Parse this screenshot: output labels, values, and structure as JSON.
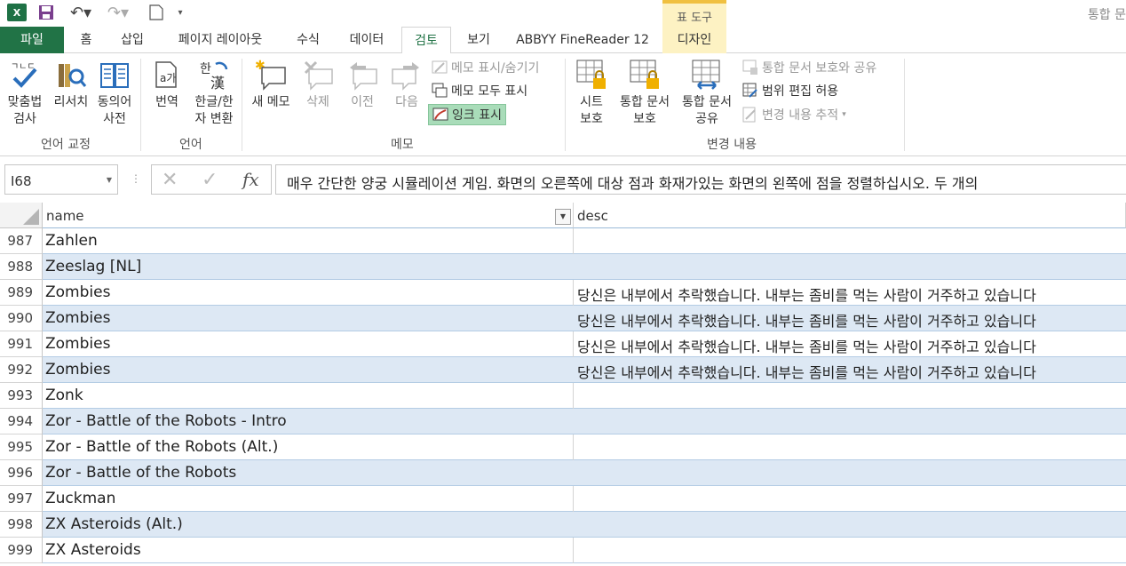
{
  "titlebar": {
    "app_icon": "excel-icon",
    "context_group_label": "표 도구",
    "right_text": "통합 문"
  },
  "tabs": [
    {
      "label": "파일",
      "key": "file"
    },
    {
      "label": "홈",
      "key": "home"
    },
    {
      "label": "삽입",
      "key": "insert"
    },
    {
      "label": "페이지 레이아웃",
      "key": "page-layout"
    },
    {
      "label": "수식",
      "key": "formulas"
    },
    {
      "label": "데이터",
      "key": "data"
    },
    {
      "label": "검토",
      "key": "review",
      "active": true
    },
    {
      "label": "보기",
      "key": "view"
    },
    {
      "label": "ABBYY FineReader 12",
      "key": "abbyy"
    },
    {
      "label": "디자인",
      "key": "design"
    }
  ],
  "ribbon": {
    "proofing": {
      "label": "언어 교정",
      "spelling": "맞춤법\n검사",
      "research": "리서치",
      "thesaurus": "동의어\n사전"
    },
    "language": {
      "label": "언어",
      "translate": "번역",
      "hanja": "한글/한\n자 변환"
    },
    "comments": {
      "label": "메모",
      "new": "새 메모",
      "delete": "삭제",
      "previous": "이전",
      "next": "다음",
      "show_hide": "메모 표시/숨기기",
      "show_all": "메모 모두 표시",
      "show_ink": "잉크 표시"
    },
    "changes": {
      "label": "변경 내용",
      "protect_sheet": "시트\n보호",
      "protect_workbook": "통합 문서\n보호",
      "share_workbook": "통합 문서\n공유",
      "protect_share": "통합 문서 보호와 공유",
      "allow_edit_ranges": "범위 편집 허용",
      "track_changes": "변경 내용 추적"
    }
  },
  "formula_bar": {
    "name_box": "I68",
    "formula": "매우 간단한 양궁 시뮬레이션 게임. 화면의 오른쪽에 대상 점과 화재가있는 화면의 왼쪽에 점을 정렬하십시오. 두 개의"
  },
  "grid": {
    "columns": [
      {
        "label": "name"
      },
      {
        "label": "desc"
      }
    ],
    "rows": [
      {
        "num": "987",
        "name": "Zahlen",
        "desc": ""
      },
      {
        "num": "988",
        "name": "Zeeslag [NL]",
        "desc": ""
      },
      {
        "num": "989",
        "name": "Zombies",
        "desc": "당신은 내부에서 추락했습니다. 내부는 좀비를 먹는 사람이 거주하고 있습니다"
      },
      {
        "num": "990",
        "name": "Zombies",
        "desc": "당신은 내부에서 추락했습니다. 내부는 좀비를 먹는 사람이 거주하고 있습니다"
      },
      {
        "num": "991",
        "name": "Zombies",
        "desc": "당신은 내부에서 추락했습니다. 내부는 좀비를 먹는 사람이 거주하고 있습니다"
      },
      {
        "num": "992",
        "name": "Zombies",
        "desc": "당신은 내부에서 추락했습니다. 내부는 좀비를 먹는 사람이 거주하고 있습니다"
      },
      {
        "num": "993",
        "name": "Zonk",
        "desc": ""
      },
      {
        "num": "994",
        "name": "Zor - Battle of the Robots - Intro",
        "desc": ""
      },
      {
        "num": "995",
        "name": "Zor - Battle of the Robots (Alt.)",
        "desc": ""
      },
      {
        "num": "996",
        "name": "Zor - Battle of the Robots",
        "desc": ""
      },
      {
        "num": "997",
        "name": "Zuckman",
        "desc": ""
      },
      {
        "num": "998",
        "name": "ZX Asteroids (Alt.)",
        "desc": ""
      },
      {
        "num": "999",
        "name": "ZX Asteroids",
        "desc": ""
      }
    ]
  },
  "colors": {
    "excel_green": "#217346",
    "band_blue": "#dde8f4",
    "context_yellow": "#fdf2c3"
  }
}
